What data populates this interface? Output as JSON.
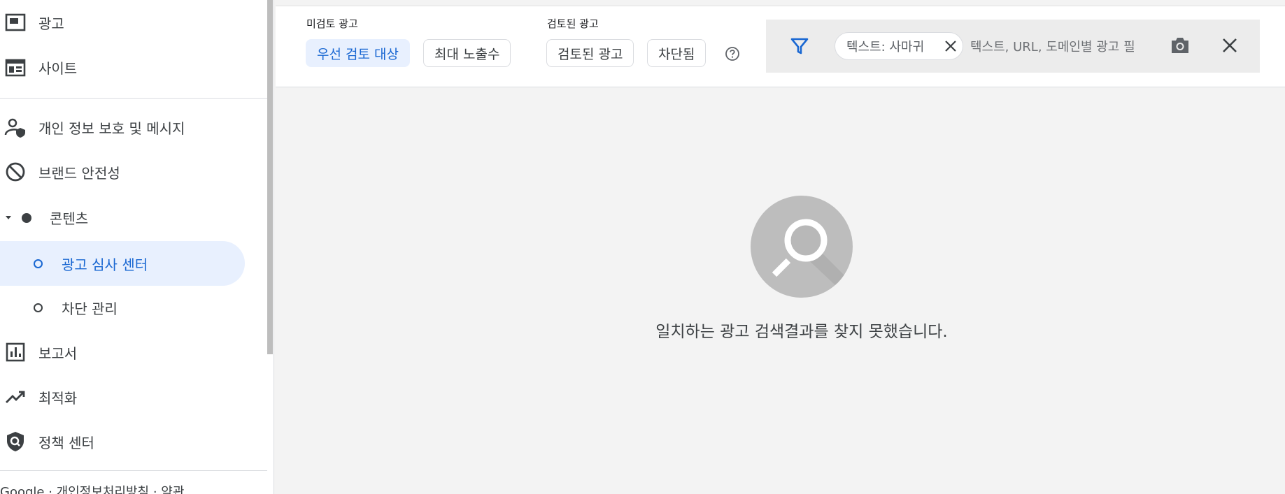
{
  "sidebar": {
    "items": [
      {
        "label": "광고",
        "icon": "ad-unit-icon"
      },
      {
        "label": "사이트",
        "icon": "site-icon"
      },
      {
        "label": "개인 정보 보호 및 메시지",
        "icon": "privacy-icon"
      },
      {
        "label": "브랜드 안전성",
        "icon": "block-icon"
      },
      {
        "label": "콘텐츠",
        "icon": "dot-icon"
      },
      {
        "label": "광고 심사 센터",
        "icon": "circle-icon"
      },
      {
        "label": "차단 관리",
        "icon": "circle-icon"
      },
      {
        "label": "보고서",
        "icon": "bar-chart-icon"
      },
      {
        "label": "최적화",
        "icon": "trending-up-icon"
      },
      {
        "label": "정책 센터",
        "icon": "policy-icon"
      }
    ],
    "footer": "Google · 개인정보처리방침 · 약관"
  },
  "toolbar": {
    "unreviewed_label": "미검토 광고",
    "reviewed_label": "검토된 광고",
    "chips": {
      "priority": "우선 검토 대상",
      "max_impressions": "최대 노출수",
      "reviewed": "검토된 광고",
      "blocked": "차단됨"
    }
  },
  "filter": {
    "chip_text": "텍스트: 사마귀",
    "placeholder": "텍스트, URL, 도메인별 광고 필"
  },
  "empty_state": {
    "message": "일치하는 광고 검색결과를 찾지 못했습니다."
  },
  "colors": {
    "accent": "#1967d2",
    "selected_bg": "#e8f0fe",
    "page_bg": "#f3f3f3"
  }
}
